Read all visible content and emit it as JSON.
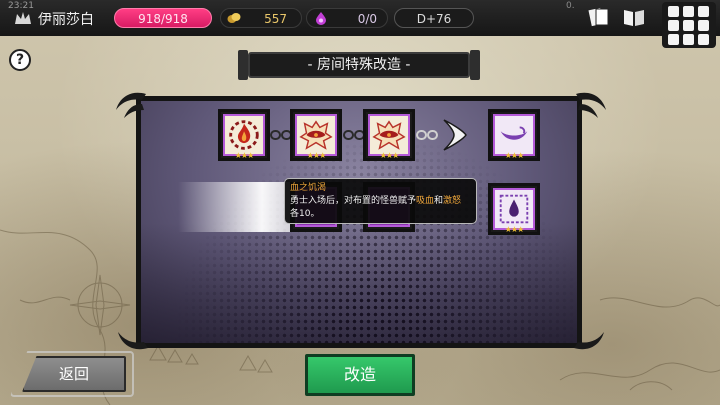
{
  "status_bar": {
    "time": "23:21",
    "right_text": "0."
  },
  "hero": {
    "name": "伊丽莎白"
  },
  "resources": {
    "hp": "918/918",
    "gold": "557",
    "souls": "0/0",
    "day": "D+76"
  },
  "help": {
    "label": "?"
  },
  "title": "- 房间特殊改造 -",
  "tiles": [
    {
      "icon": "fire-gear-icon",
      "stars": "★★★"
    },
    {
      "icon": "bat-wing-icon",
      "stars": "★★★"
    },
    {
      "icon": "bat-wing-icon",
      "stars": "★★★"
    },
    {
      "icon": "crescent-icon",
      "stars": "★★★"
    },
    {
      "icon": "blood-drop-icon",
      "stars": "★★★"
    }
  ],
  "tooltip": {
    "title": "血之饥渴",
    "line1_a": "勇士入场后，对布置的怪兽赋予",
    "hl1": "吸血",
    "and": "和",
    "hl2": "激怒",
    "line2": "各10。"
  },
  "buttons": {
    "back": "返回",
    "modify": "改造"
  },
  "colors": {
    "hp": "#e0246e",
    "gold_text": "#e8c66a",
    "accent_orange": "#f2a93b",
    "tile_purple": "#8a2fb0",
    "modify_green": "#27b05a"
  }
}
